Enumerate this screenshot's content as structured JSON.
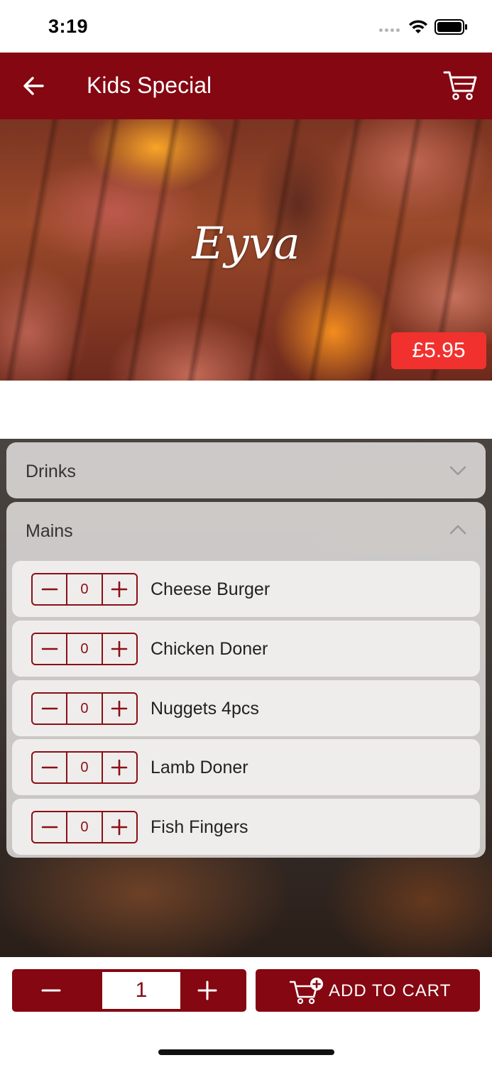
{
  "status_bar": {
    "time": "3:19"
  },
  "app_bar": {
    "title": "Kids Special",
    "back_icon": "arrow-left-icon",
    "cart_icon": "shopping-cart-icon"
  },
  "hero": {
    "logo_text": "Eyva",
    "price": "£5.95"
  },
  "accordion": {
    "drinks": {
      "title": "Drinks",
      "expanded": false
    },
    "mains": {
      "title": "Mains",
      "expanded": true,
      "items": [
        {
          "name": "Cheese Burger",
          "qty": "0"
        },
        {
          "name": "Chicken Doner",
          "qty": "0"
        },
        {
          "name": "Nuggets 4pcs",
          "qty": "0"
        },
        {
          "name": "Lamb Doner",
          "qty": "0"
        },
        {
          "name": "Fish Fingers",
          "qty": "0"
        }
      ]
    }
  },
  "bottom_bar": {
    "quantity": "1",
    "add_to_cart_label": "ADD TO CART"
  },
  "colors": {
    "primary": "#850711",
    "price_badge": "#f0312e",
    "stepper": "#8a1016"
  }
}
